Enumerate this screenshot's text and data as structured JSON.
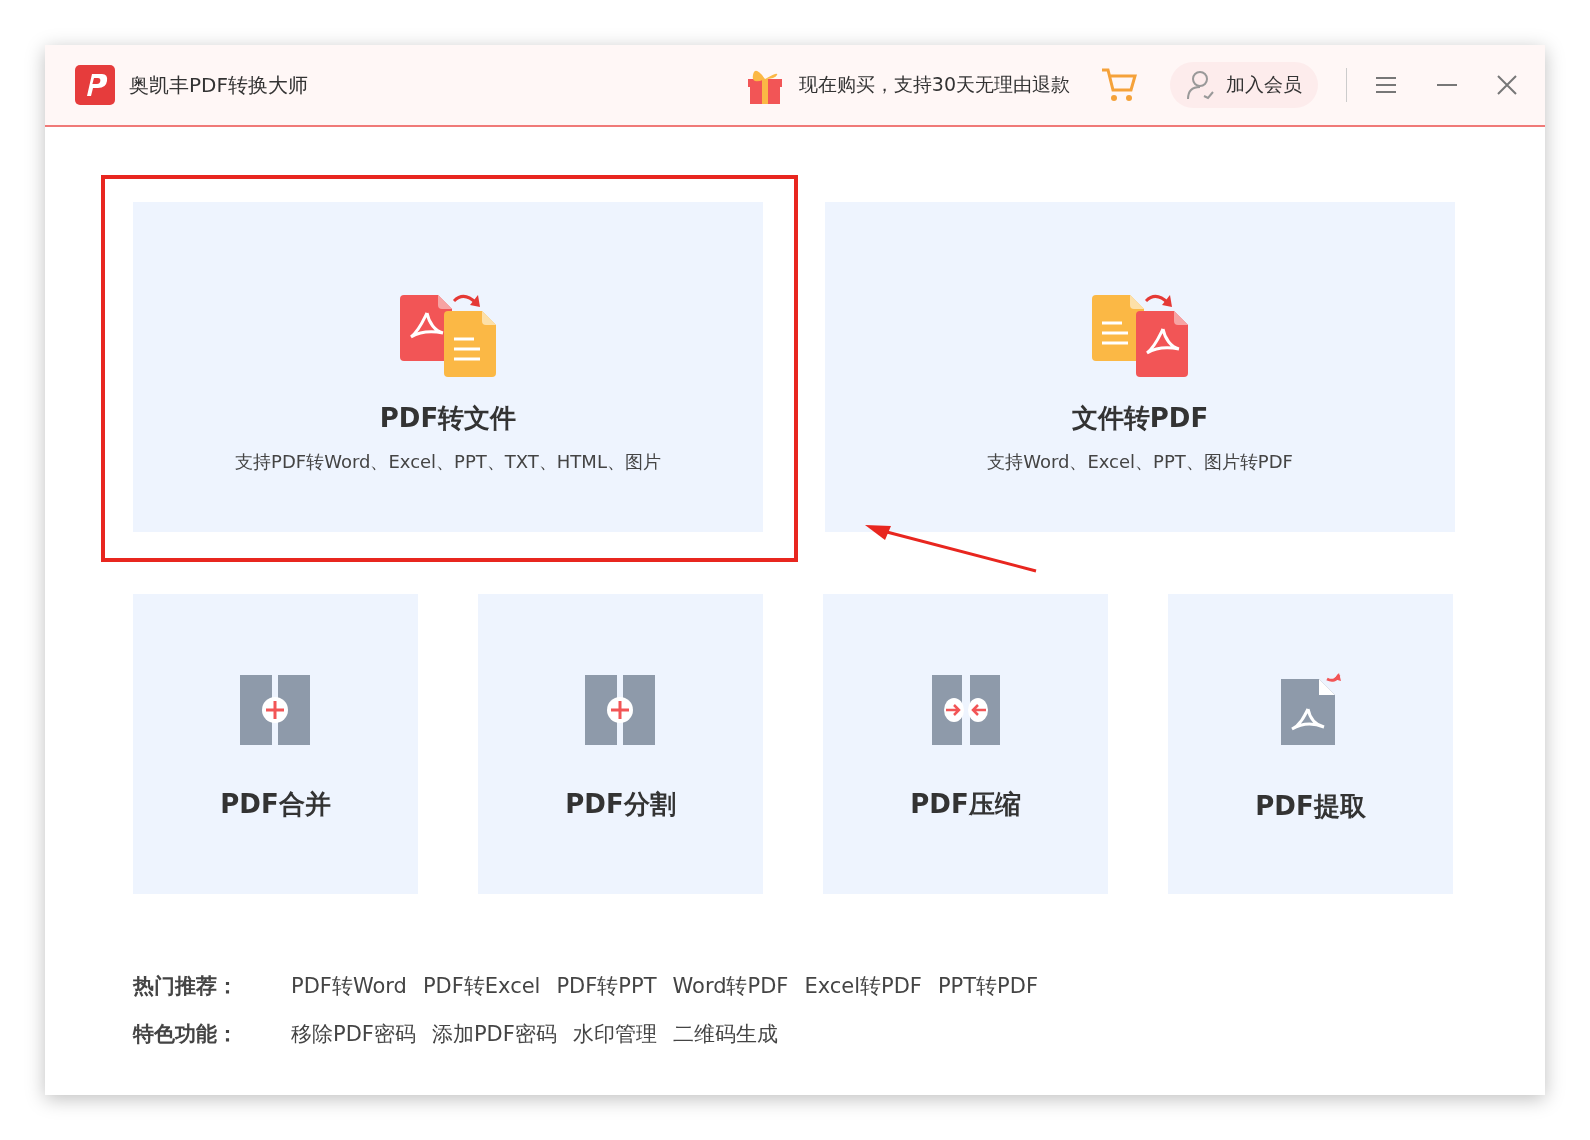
{
  "window": {
    "title": "奥凯丰PDF转换大师"
  },
  "header": {
    "promo": "现在购买，支持30天无理由退款",
    "member_button": "加入会员"
  },
  "main_cards": [
    {
      "kind": "pdf-to-file",
      "title": "PDF转文件",
      "subtitle": "支持PDF转Word、Excel、PPT、TXT、HTML、图片",
      "highlighted": true
    },
    {
      "kind": "file-to-pdf",
      "title": "文件转PDF",
      "subtitle": "支持Word、Excel、PPT、图片转PDF",
      "highlighted": false
    }
  ],
  "tool_cards": [
    {
      "kind": "merge",
      "title": "PDF合并"
    },
    {
      "kind": "split",
      "title": "PDF分割"
    },
    {
      "kind": "compress",
      "title": "PDF压缩"
    },
    {
      "kind": "extract",
      "title": "PDF提取"
    }
  ],
  "link_rows": [
    {
      "label": "热门推荐：",
      "links": [
        "PDF转Word",
        "PDF转Excel",
        "PDF转PPT",
        "Word转PDF",
        "Excel转PDF",
        "PPT转PDF"
      ]
    },
    {
      "label": "特色功能：",
      "links": [
        "移除PDF密码",
        "添加PDF密码",
        "水印管理",
        "二维码生成"
      ]
    }
  ]
}
